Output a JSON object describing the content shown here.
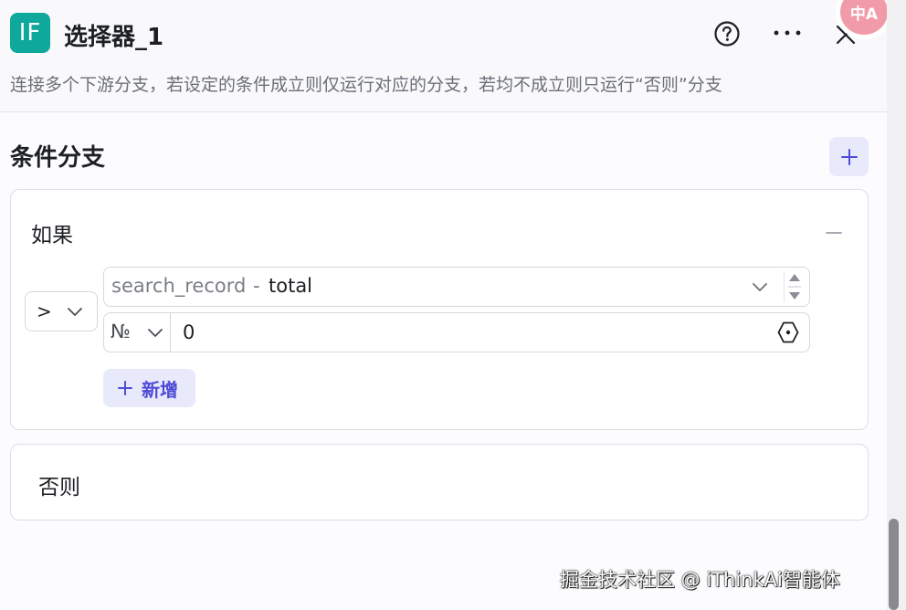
{
  "header": {
    "node_icon_text": "IF",
    "title": "选择器_1",
    "description": "连接多个下游分支，若设定的条件成立则仅运行对应的分支，若均不成立则只运行“否则”分支",
    "icons": [
      "help-icon",
      "more-icon",
      "close-icon"
    ],
    "translate_badge": "中A"
  },
  "section": {
    "title": "条件分支",
    "add_icon": "plus-icon"
  },
  "branch_if": {
    "label": "如果",
    "collapse_icon": "minus-icon",
    "condition": {
      "operator": ">",
      "variable_prefix": "search_record",
      "variable_separator": "-",
      "variable_field": "total",
      "value_type": "№",
      "value": "0"
    },
    "add_condition_label": "新增"
  },
  "branch_else": {
    "label": "否则"
  },
  "watermark": "掘金技术社区 @ iThinkAi智能体",
  "colors": {
    "accent": "#4e4bd6",
    "accent_bg": "#e8e9fb",
    "node_icon": "#0fa89c"
  }
}
